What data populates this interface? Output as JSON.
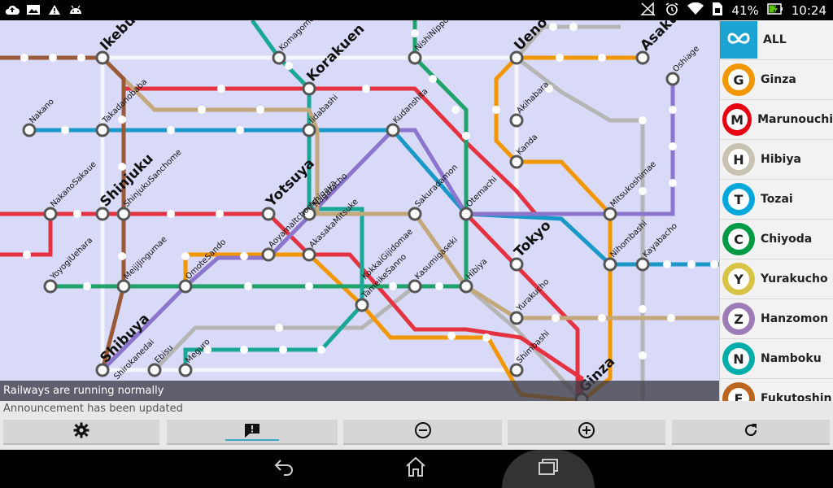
{
  "status": {
    "battery": "41%",
    "time": "10:24"
  },
  "map": {
    "stations": [
      {
        "name": "Ikebukuro",
        "major": true
      },
      {
        "name": "Komagome",
        "major": false
      },
      {
        "name": "Korakuen",
        "major": true
      },
      {
        "name": "NishiNippori",
        "major": false
      },
      {
        "name": "Ueno",
        "major": true
      },
      {
        "name": "Asakusa",
        "major": true
      },
      {
        "name": "Oshiage",
        "major": false
      },
      {
        "name": "Takadanobaba",
        "major": false
      },
      {
        "name": "Nakano",
        "major": false
      },
      {
        "name": "Iidabashi",
        "major": false
      },
      {
        "name": "Kudanshita",
        "major": false
      },
      {
        "name": "Akihabara",
        "major": false
      },
      {
        "name": "Kanda",
        "major": false
      },
      {
        "name": "Shinjuku",
        "major": true
      },
      {
        "name": "ShinjukuSanchome",
        "major": false
      },
      {
        "name": "NakanoSakaue",
        "major": false
      },
      {
        "name": "Yotsuya",
        "major": true
      },
      {
        "name": "Ichigaya",
        "major": false
      },
      {
        "name": "Nagatacho",
        "major": false
      },
      {
        "name": "AkasakaMitsuke",
        "major": false
      },
      {
        "name": "Sakuradamon",
        "major": false
      },
      {
        "name": "Otemachi",
        "major": false
      },
      {
        "name": "Mitsukoshimae",
        "major": false
      },
      {
        "name": "AoyamaItchome",
        "major": false
      },
      {
        "name": "YoyogiUehara",
        "major": false
      },
      {
        "name": "MeijiJingumae",
        "major": false
      },
      {
        "name": "OmoteSando",
        "major": false
      },
      {
        "name": "Tokyo",
        "major": true
      },
      {
        "name": "Nihombashi",
        "major": false
      },
      {
        "name": "Kayabacho",
        "major": false
      },
      {
        "name": "KokkaiGijidomae",
        "major": false
      },
      {
        "name": "TameikeSanno",
        "major": false
      },
      {
        "name": "Kasumigaseki",
        "major": false
      },
      {
        "name": "Hibiya",
        "major": false
      },
      {
        "name": "Yurakucho",
        "major": false
      },
      {
        "name": "Shibuya",
        "major": true
      },
      {
        "name": "Ebisu",
        "major": false
      },
      {
        "name": "Meguro",
        "major": false
      },
      {
        "name": "Shirokanedai",
        "major": false
      },
      {
        "name": "Shimbashi",
        "major": false
      },
      {
        "name": "Ginza",
        "major": true
      }
    ]
  },
  "banner": "Railways are running normally",
  "announcement": "Announcement has been updated",
  "sidebar": {
    "items": [
      {
        "label": "ALL",
        "letter": "",
        "color": "#1ba3d3"
      },
      {
        "label": "Ginza",
        "letter": "G",
        "color": "#f39700"
      },
      {
        "label": "Marunouchi",
        "letter": "M",
        "color": "#e60012"
      },
      {
        "label": "Hibiya",
        "letter": "H",
        "color": "#c8c2b2"
      },
      {
        "label": "Tozai",
        "letter": "T",
        "color": "#00a7db"
      },
      {
        "label": "Chiyoda",
        "letter": "C",
        "color": "#009944"
      },
      {
        "label": "Yurakucho",
        "letter": "Y",
        "color": "#d7c447"
      },
      {
        "label": "Hanzomon",
        "letter": "Z",
        "color": "#9b7cb6"
      },
      {
        "label": "Namboku",
        "letter": "N",
        "color": "#00ada9"
      },
      {
        "label": "Fukutoshin",
        "letter": "F",
        "color": "#bb641d"
      }
    ]
  },
  "toolbar": {
    "buttons": [
      {
        "icon": "gear-icon"
      },
      {
        "icon": "announcement-icon"
      },
      {
        "icon": "zoom-out-icon"
      },
      {
        "icon": "zoom-in-icon"
      },
      {
        "icon": "refresh-icon"
      }
    ]
  },
  "navbar": {
    "buttons": [
      "back-icon",
      "home-icon",
      "recent-apps-icon"
    ]
  }
}
